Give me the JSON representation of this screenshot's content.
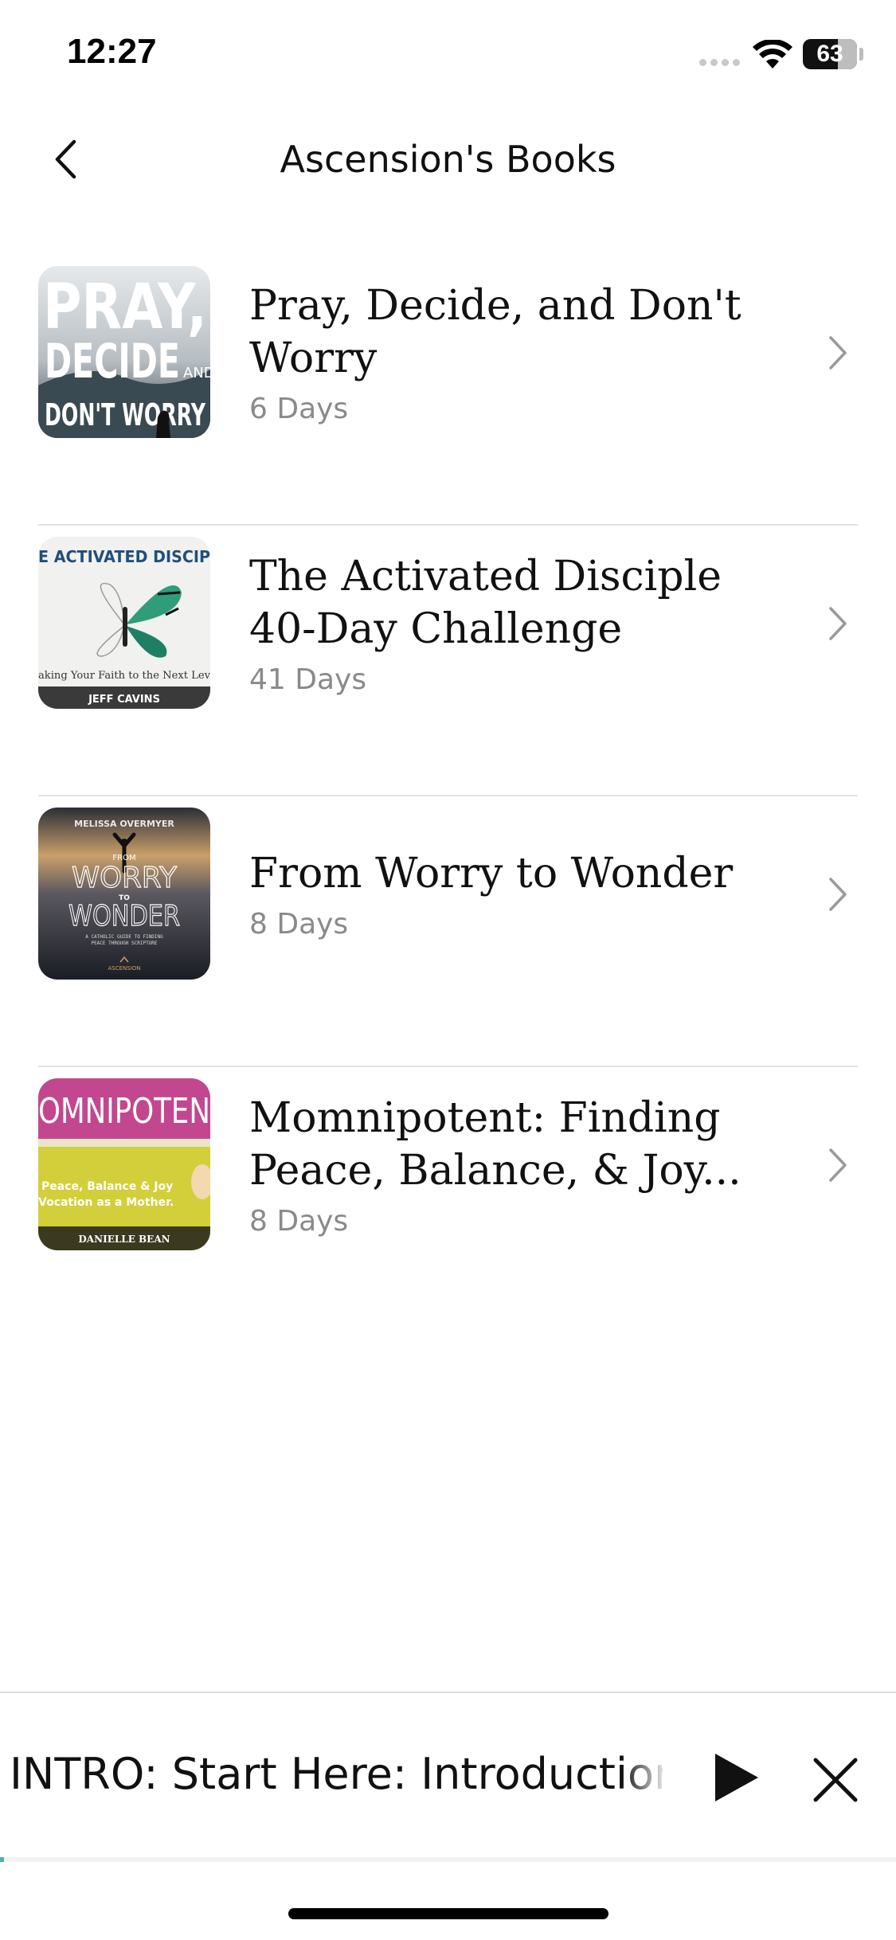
{
  "status_bar": {
    "time": "12:27",
    "battery": "63",
    "icons": [
      "signal-icon",
      "wifi-icon",
      "battery-icon"
    ]
  },
  "header": {
    "title": "Ascension's Books",
    "back_icon": "chevron-left-icon"
  },
  "books": [
    {
      "title": "Pray, Decide, and Don't Worry",
      "days": "6 Days",
      "cover": {
        "lines": [
          "PRAY,",
          "DECIDE",
          "AND",
          "DON'T WORRY"
        ],
        "colors": {
          "sky": "#c9ced2",
          "ground": "#3a4a52"
        }
      }
    },
    {
      "title": "The Activated Disciple 40-Day Challenge",
      "days": "41 Days",
      "cover": {
        "top": "E ACTIVATED DISCIP",
        "subtitle": "aking Your Faith to the Next Lev",
        "author": "JEFF CAVINS",
        "colors": {
          "bg": "#f1f1ef",
          "butterfly": "#2f9c7a",
          "band": "#3a3a3a"
        }
      }
    },
    {
      "title": "From Worry to Wonder",
      "days": "8 Days",
      "cover": {
        "author": "MELISSA OVERMYER",
        "lines": [
          "FROM",
          "WORRY",
          "TO",
          "WONDER"
        ],
        "tagline1": "A CATHOLIC GUIDE TO FINDING",
        "tagline2": "PEACE THROUGH SCRIPTURE",
        "publisher": "ASCENSION",
        "colors": {
          "top": "#caa06a",
          "mid": "#4a4a52",
          "bottom": "#1a1d24"
        }
      }
    },
    {
      "title": "Momnipotent: Finding Peace, Balance, & Joy...",
      "days": "8 Days",
      "cover": {
        "top": "OMNIPOTEN",
        "line1": "Peace, Balance & Joy",
        "line2": "Vocation as a Mother.",
        "author": "DANIELLE BEAN",
        "colors": {
          "top": "#c2478f",
          "mid": "#d2cf3a",
          "band": "#3b3a20"
        }
      }
    }
  ],
  "row_icon": "chevron-right-icon",
  "mini_player": {
    "title": "INTRO: Start Here: Introduction",
    "play_icon": "play-icon",
    "close_icon": "close-icon",
    "progress": 0.003
  }
}
